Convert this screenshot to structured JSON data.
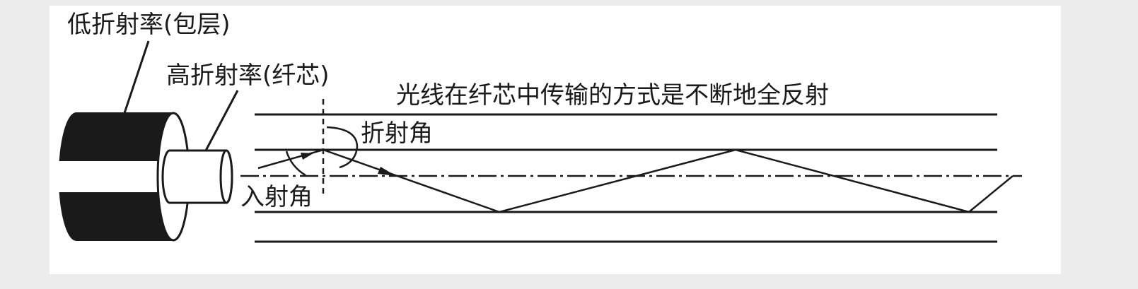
{
  "labels": {
    "cladding": "低折射率(包层)",
    "core": "高折射率(纤芯)",
    "caption": "光线在纤芯中传输的方式是不断地全反射",
    "refraction_angle": "折射角",
    "incidence_angle": "入射角"
  },
  "colors": {
    "background": "#ececec",
    "panel": "#ffffff",
    "ink": "#1a1a1a"
  }
}
